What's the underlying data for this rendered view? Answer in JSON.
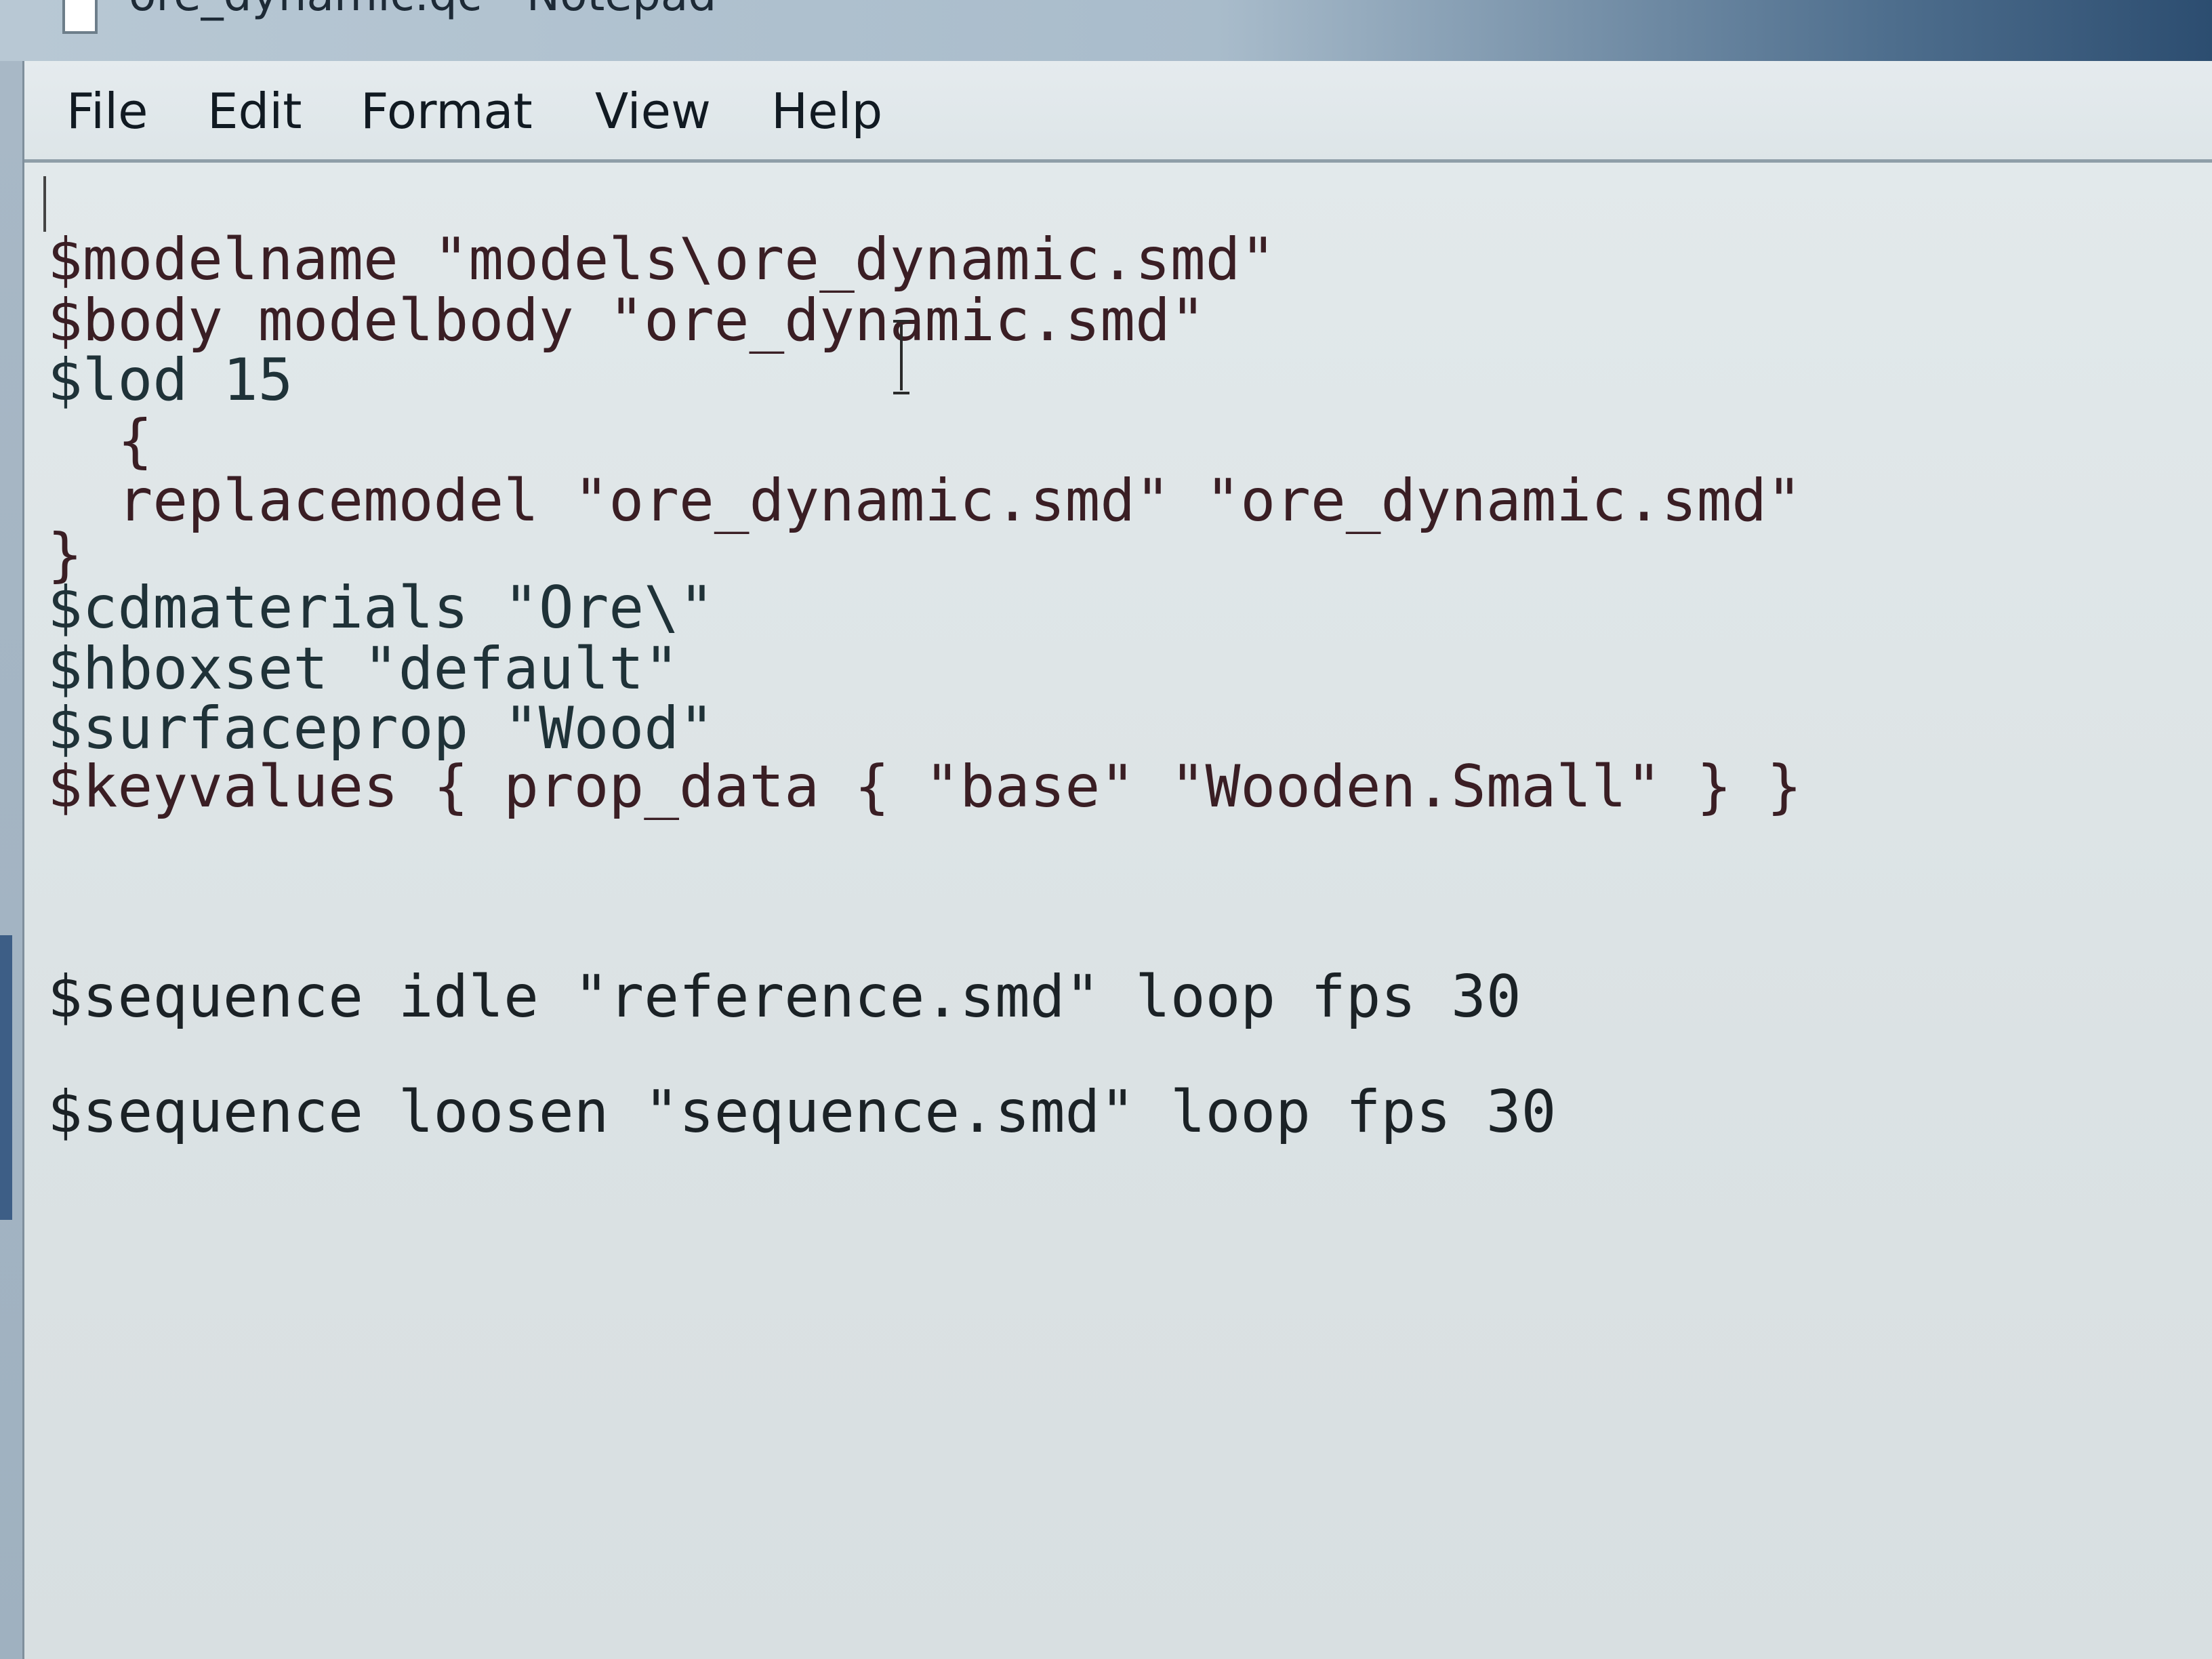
{
  "window": {
    "title": "ore_dynamic.qc - Notepad"
  },
  "menu": {
    "items": [
      {
        "label": "File"
      },
      {
        "label": "Edit"
      },
      {
        "label": "Format"
      },
      {
        "label": "View"
      },
      {
        "label": "Help"
      }
    ]
  },
  "editor": {
    "lines": [
      "$modelname \"models\\ore_dynamic.smd\"",
      "$body modelbody \"ore_dynamic.smd\"",
      "$lod 15",
      "  {",
      "  replacemodel \"ore_dynamic.smd\" \"ore_dynamic.smd\"",
      "}",
      "$cdmaterials \"Ore\\\"",
      "$hboxset \"default\"",
      "$surfaceprop \"Wood\"",
      "$keyvalues { prop_data { \"base\" \"Wooden.Small\" } }",
      "$sequence idle \"reference.smd\" loop fps 30",
      "$sequence loosen \"sequence.smd\" loop fps 30"
    ]
  },
  "icons": {
    "app": "notepad-icon",
    "cursor": "text-cursor-icon"
  }
}
